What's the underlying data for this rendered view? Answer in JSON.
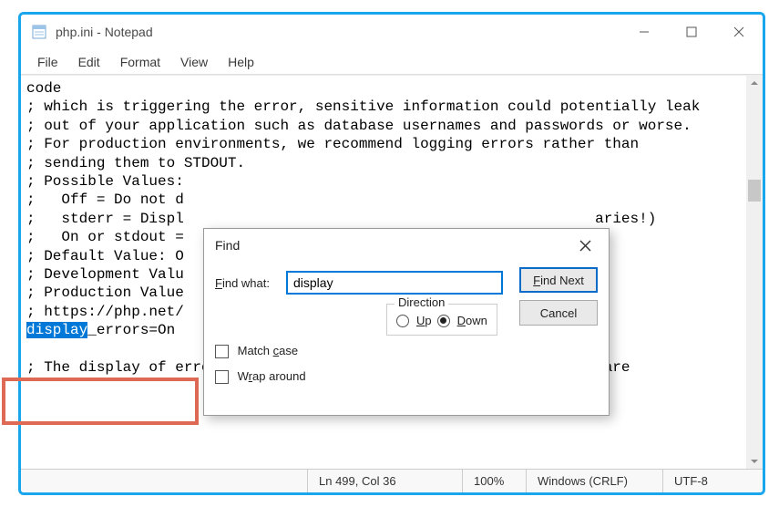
{
  "titlebar": {
    "title": "php.ini - Notepad"
  },
  "menubar": {
    "items": [
      "File",
      "Edit",
      "Format",
      "View",
      "Help"
    ]
  },
  "editor": {
    "line1": "code",
    "line2": "; which is triggering the error, sensitive information could potentially leak",
    "line3": "; out of your application such as database usernames and passwords or worse.",
    "line4": "; For production environments, we recommend logging errors rather than",
    "line5": "; sending them to STDOUT.",
    "line6": "; Possible Values:",
    "line7start": ";   Off = Do not d",
    "line8start": ";   stderr = Displ",
    "line8end": "aries!)",
    "line9start": ";   On or stdout =",
    "line10start": "; Default Value: O",
    "line11start": "; Development Valu",
    "line12start": "; Production Value",
    "line13start": "; https://php.net/",
    "line14_sel": "display",
    "line14_rest": "_errors=On",
    "line_blank": "",
    "line15": "; The display of errors which occur during PHP's startup sequence are"
  },
  "find": {
    "title": "Find",
    "findwhat_label": "Find what:",
    "findwhat_value": "display",
    "findnext": "Find Next",
    "cancel": "Cancel",
    "direction_label": "Direction",
    "up": "Up",
    "down": "Down",
    "matchcase": "Match case",
    "wraparound": "Wrap around"
  },
  "status": {
    "pos": "Ln 499, Col 36",
    "zoom": "100%",
    "eol": "Windows (CRLF)",
    "enc": "UTF-8"
  }
}
